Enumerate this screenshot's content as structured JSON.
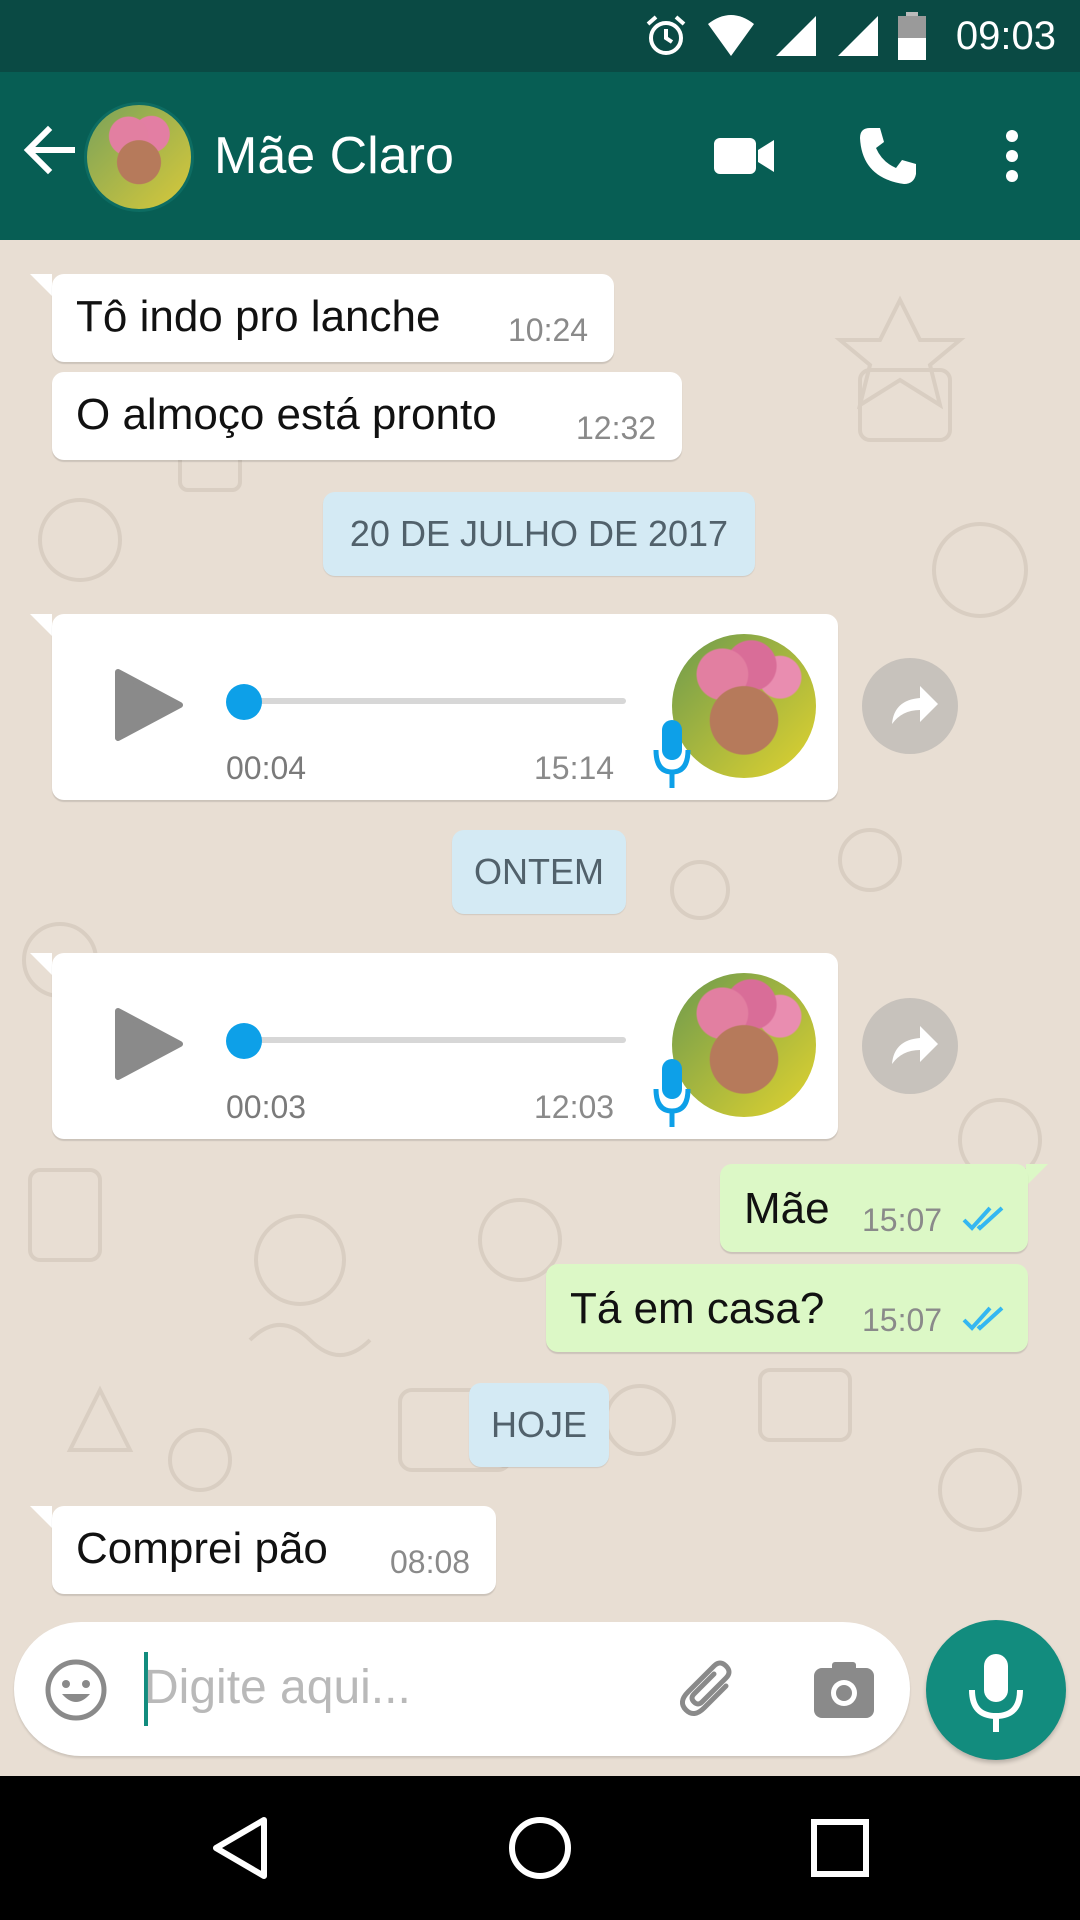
{
  "status_bar": {
    "time": "09:03"
  },
  "header": {
    "contact_name": "Mãe Claro"
  },
  "messages": [
    {
      "text": "Tô indo pro lanche",
      "time": "10:24"
    },
    {
      "text": "O almoço está pronto",
      "time": "12:32"
    }
  ],
  "date_1": "20 DE JULHO DE 2017",
  "voice_1": {
    "duration": "00:04",
    "time": "15:14"
  },
  "date_2": "ONTEM",
  "voice_2": {
    "duration": "00:03",
    "time": "12:03"
  },
  "outgoing": [
    {
      "text": "Mãe",
      "time": "15:07"
    },
    {
      "text": "Tá em casa?",
      "time": "15:07"
    }
  ],
  "date_3": "HOJE",
  "last_message": {
    "text": "Comprei pão",
    "time": "08:08"
  },
  "input": {
    "placeholder": "Digite aqui..."
  },
  "colors": {
    "header": "#075e54",
    "status_bar": "#0a4a44",
    "accent": "#128c7e",
    "outgoing_bubble": "#dcf8c6",
    "date_chip": "#d4eaf4",
    "read_ticks": "#34b7f1"
  }
}
